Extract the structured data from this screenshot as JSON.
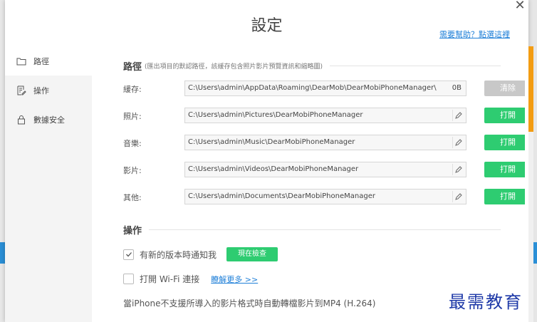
{
  "window": {
    "title": "設定",
    "help_link": "需要幫助？點選這裡"
  },
  "sidebar": {
    "items": [
      {
        "label": "路徑"
      },
      {
        "label": "操作"
      },
      {
        "label": "數據安全"
      }
    ]
  },
  "path_section": {
    "title": "路徑",
    "note": "(匯出項目的默認路徑，該緩存包含照片影片預覽資訊和縮略圖)",
    "rows": [
      {
        "label": "緩存:",
        "path": "C:\\Users\\admin\\AppData\\Roaming\\DearMob\\DearMobiPhoneManager\\",
        "size": "0B",
        "button": "清除"
      },
      {
        "label": "照片:",
        "path": "C:\\Users\\admin\\Pictures\\DearMobiPhoneManager",
        "button": "打開"
      },
      {
        "label": "音樂:",
        "path": "C:\\Users\\admin\\Music\\DearMobiPhoneManager",
        "button": "打開"
      },
      {
        "label": "影片:",
        "path": "C:\\Users\\admin\\Videos\\DearMobiPhoneManager",
        "button": "打開"
      },
      {
        "label": "其他:",
        "path": "C:\\Users\\admin\\Documents\\DearMobiPhoneManager",
        "button": "打開"
      }
    ]
  },
  "operation_section": {
    "title": "操作",
    "notify_label": "有新的版本時通知我",
    "check_now_button": "現在檢查",
    "wifi_label": "打開 Wi-Fi 連接",
    "learn_more": "瞭解更多 >>",
    "convert_text": "當iPhone不支援所導入的影片格式時自動轉檔影片到MP4 (H.264)"
  },
  "watermark": "最需教育",
  "colors": {
    "accent_green": "#2ecc71",
    "link_blue": "#1e7fd8",
    "scroll_orange": "#f39c12"
  }
}
